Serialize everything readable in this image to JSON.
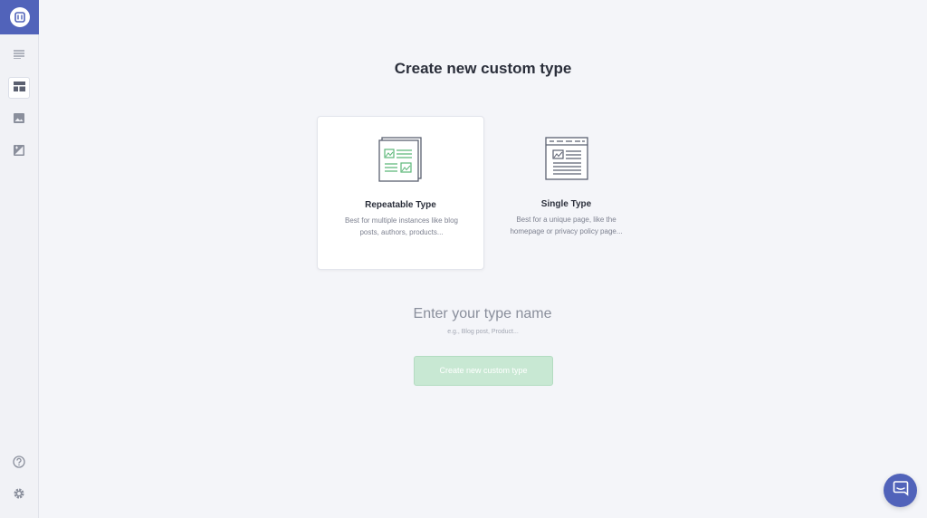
{
  "sidebar": {
    "brand_color": "#5163ba",
    "items": [
      {
        "icon": "list-icon",
        "active": false
      },
      {
        "icon": "layout-icon",
        "active": true
      },
      {
        "icon": "image-icon",
        "active": false
      },
      {
        "icon": "image-edit-icon",
        "active": false
      }
    ],
    "bottom": [
      {
        "icon": "help-icon"
      },
      {
        "icon": "gear-icon"
      }
    ]
  },
  "main": {
    "title": "Create new custom type",
    "cards": [
      {
        "title": "Repeatable Type",
        "description": "Best for multiple instances like blog posts, authors, products...",
        "selected": true,
        "icon": "repeatable-type-icon"
      },
      {
        "title": "Single Type",
        "description": "Best for a unique page, like the homepage or privacy policy page...",
        "selected": false,
        "icon": "single-type-icon"
      }
    ],
    "name_input": {
      "value": "",
      "placeholder": "Enter your type name"
    },
    "hint": "e.g., Blog post, Product...",
    "create_button": "Create new custom type"
  },
  "chat": {
    "icon": "chat-icon"
  },
  "colors": {
    "accent_green": "#5cb779",
    "button_disabled": "#c8e8d3"
  }
}
